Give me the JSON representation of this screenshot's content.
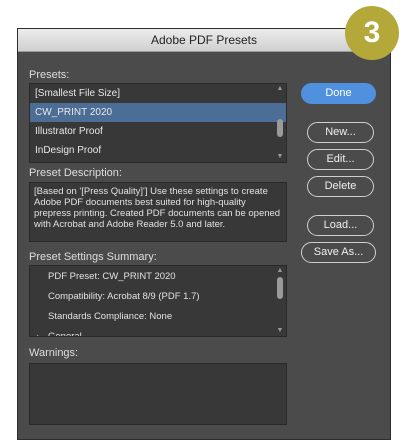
{
  "badge": "3",
  "dialog": {
    "title": "Adobe PDF Presets",
    "presets_label": "Presets:",
    "presets": [
      {
        "label": "[Smallest File Size]",
        "selected": false
      },
      {
        "label": "CW_PRINT 2020",
        "selected": true
      },
      {
        "label": "Illustrator Proof",
        "selected": false
      },
      {
        "label": "InDesign Proof",
        "selected": false
      }
    ],
    "description_label": "Preset Description:",
    "description_text": "[Based on '[Press Quality]'] Use these settings to create Adobe PDF documents best suited for high-quality prepress printing. Created PDF documents can be opened with Acrobat and Adobe Reader 5.0 and later.",
    "summary_label": "Preset Settings Summary:",
    "summary": [
      {
        "label": "PDF Preset: CW_PRINT 2020",
        "expander": ""
      },
      {
        "label": "Compatibility: Acrobat 8/9 (PDF 1.7)",
        "expander": ""
      },
      {
        "label": "Standards Compliance: None",
        "expander": ""
      },
      {
        "label": "General",
        "expander": "›"
      }
    ],
    "warnings_label": "Warnings:",
    "buttons": {
      "done": "Done",
      "new": "New...",
      "edit": "Edit...",
      "delete": "Delete",
      "load": "Load...",
      "save_as": "Save As..."
    }
  },
  "colors": {
    "dialog_bg": "#4b4b4b",
    "field_bg": "#383838",
    "selection": "#4c6d95",
    "primary_button": "#4f90df",
    "badge": "#b5a83b"
  }
}
